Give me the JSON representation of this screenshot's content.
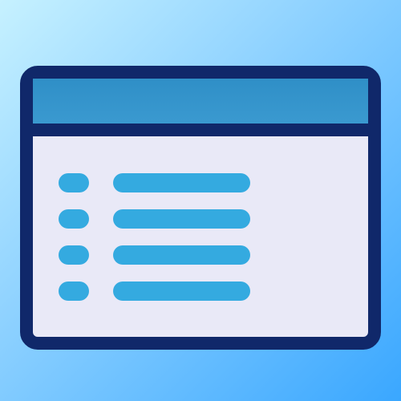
{
  "icon": {
    "name": "window-list-icon",
    "colors": {
      "background_top_left": "#c6f1ff",
      "background_bottom_right": "#3aa7ff",
      "frame_stroke": "#10286a",
      "titlebar_top": "#2f8fc7",
      "titlebar_bottom": "#3c9bd1",
      "content_bg": "#e9e9f7",
      "list_items": "#34aae0"
    },
    "list_rows": 4
  }
}
